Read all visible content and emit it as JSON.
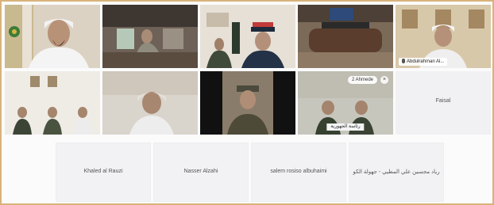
{
  "meeting": {
    "row1": [
      {
        "name": ""
      },
      {
        "name": ""
      },
      {
        "name": ""
      },
      {
        "name": ""
      },
      {
        "name": "Abdulrahman Al..."
      }
    ],
    "row2": [
      {
        "name": ""
      },
      {
        "name": ""
      },
      {
        "name": ""
      },
      {
        "name": "",
        "caption": "رئاسة الجهورية",
        "badge": "2 Ahmede",
        "close": "×"
      },
      {
        "name": "Faisal"
      }
    ],
    "row3": [
      {
        "name": "Khaled al Rauzi"
      },
      {
        "name": "Nasser Alzahi"
      },
      {
        "name": "salem rosiso albuhaimi"
      },
      {
        "name": "رياد مجسين علي المطيي - جهولة الكو"
      }
    ]
  },
  "icons": {
    "mic": "mic-icon",
    "close": "close-icon"
  }
}
